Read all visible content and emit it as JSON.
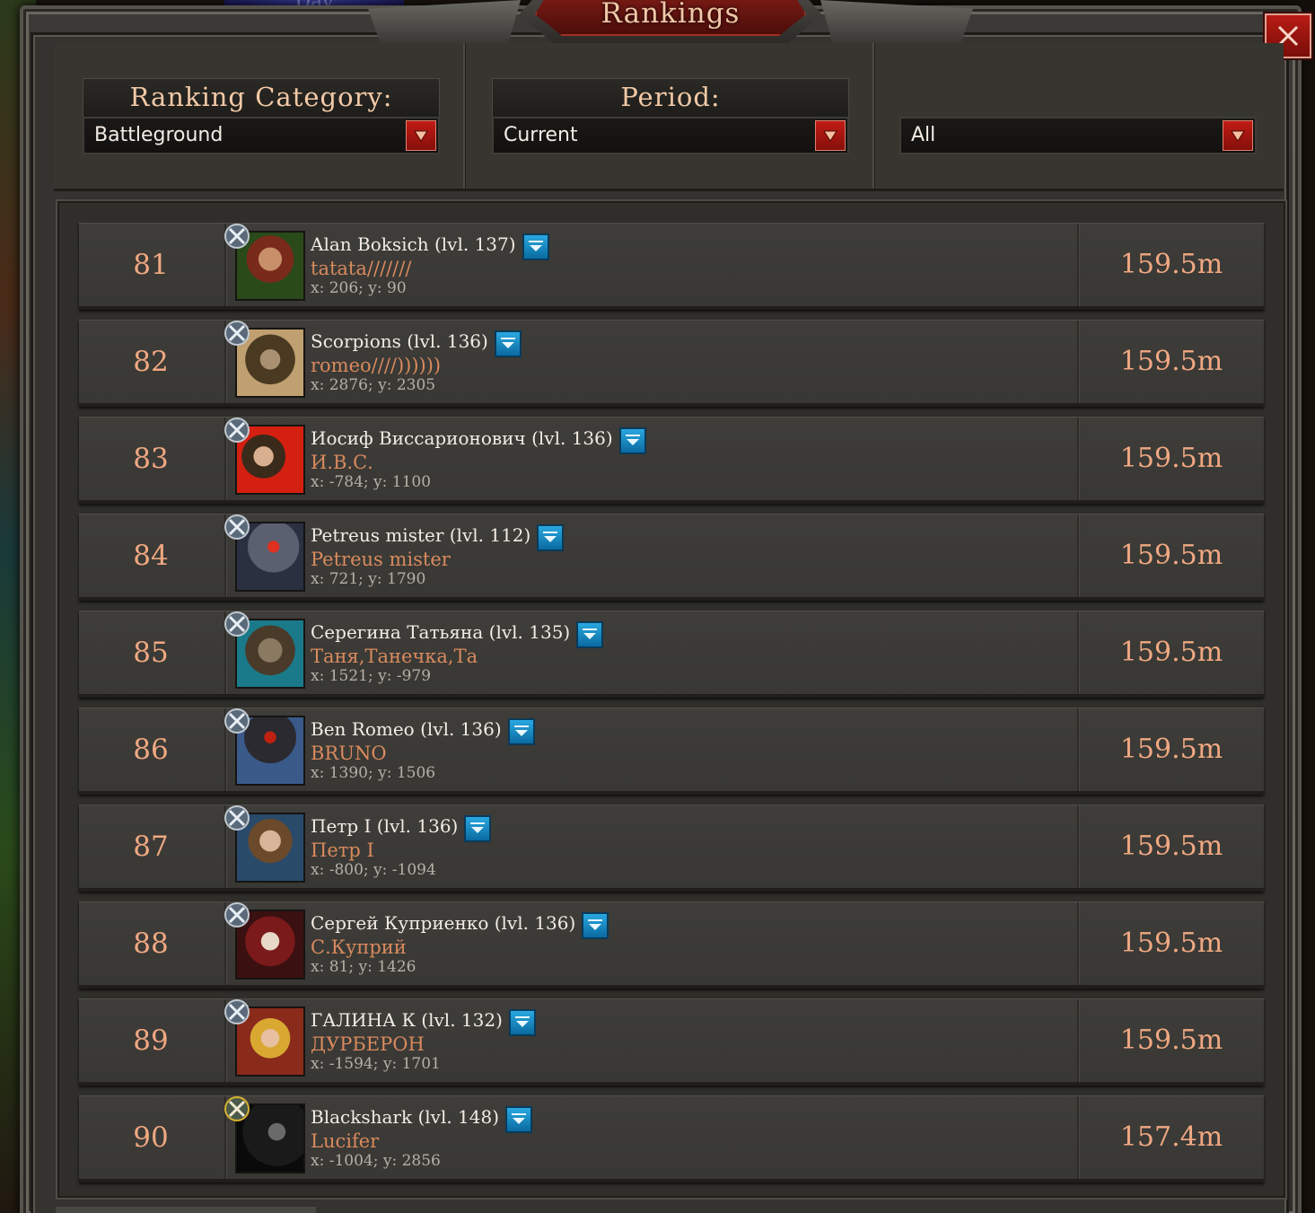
{
  "window": {
    "title": "Rankings",
    "background_title_fragment": "Day"
  },
  "filters": {
    "category": {
      "label": "Ranking Category:",
      "value": "Battleground"
    },
    "period": {
      "label": "Period:",
      "value": "Current"
    },
    "scope": {
      "label": "",
      "value": "All"
    }
  },
  "colors": {
    "accent_red": "#b81c14",
    "rank_text": "#f0a882",
    "alliance_text": "#d98a5e",
    "info_button_blue": "#2aa8e0"
  },
  "rows": [
    {
      "rank": "81",
      "name": "Alan Boksich (lvl. 137)",
      "alliance": "tatata///////",
      "coords": "x: 206; y: 90",
      "score": "159.5m",
      "badge": "silver-swords-icon"
    },
    {
      "rank": "82",
      "name": "Scorpions (lvl. 136)",
      "alliance": "romeo////))))))",
      "coords": "x: 2876; y: 2305",
      "score": "159.5m",
      "badge": "silver-swords-icon"
    },
    {
      "rank": "83",
      "name": "Иосиф Виссарионович (lvl. 136)",
      "alliance": "И.В.С.",
      "coords": "x: -784; y: 1100",
      "score": "159.5m",
      "badge": "silver-swords-icon"
    },
    {
      "rank": "84",
      "name": "Petreus mister (lvl. 112)",
      "alliance": "Petreus mister",
      "coords": "x: 721; y: 1790",
      "score": "159.5m",
      "badge": "silver-swords-icon"
    },
    {
      "rank": "85",
      "name": "Серегина Татьяна (lvl. 135)",
      "alliance": "Таня,Танечка,Та",
      "coords": "x: 1521; y: -979",
      "score": "159.5m",
      "badge": "silver-swords-icon"
    },
    {
      "rank": "86",
      "name": "Ben Romeo (lvl. 136)",
      "alliance": "BRUNO",
      "coords": "x: 1390; y: 1506",
      "score": "159.5m",
      "badge": "silver-swords-icon"
    },
    {
      "rank": "87",
      "name": "Петр I (lvl. 136)",
      "alliance": "Петр I",
      "coords": "x: -800; y: -1094",
      "score": "159.5m",
      "badge": "silver-swords-icon"
    },
    {
      "rank": "88",
      "name": "Сергей Куприенко (lvl. 136)",
      "alliance": "С.Куприй",
      "coords": "x: 81; y: 1426",
      "score": "159.5m",
      "badge": "silver-swords-icon"
    },
    {
      "rank": "89",
      "name": "ГАЛИНА К (lvl. 132)",
      "alliance": "ДУРБЕРОН",
      "coords": "x: -1594; y: 1701",
      "score": "159.5m",
      "badge": "silver-swords-icon"
    },
    {
      "rank": "90",
      "name": "Blackshark (lvl. 148)",
      "alliance": "Lucifer",
      "coords": "x: -1004; y: 2856",
      "score": "157.4m",
      "badge": "gold-swords-icon"
    }
  ]
}
